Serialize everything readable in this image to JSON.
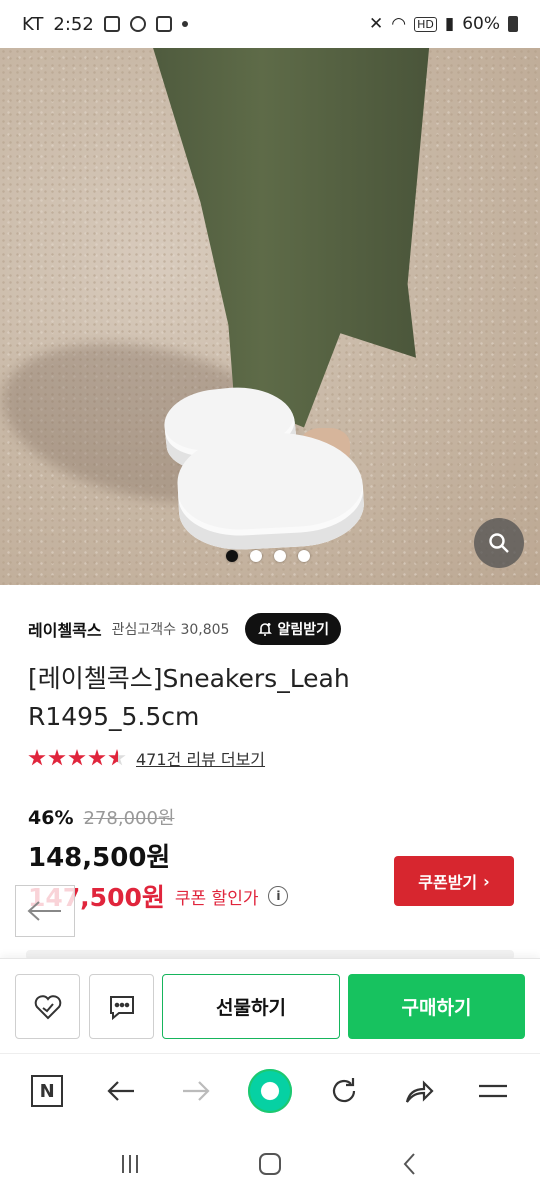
{
  "status_bar": {
    "carrier": "KT",
    "time": "2:52",
    "battery": "60%"
  },
  "hero": {
    "image_alt": "White platform sneakers on sandy ground",
    "carousel_pages": 4,
    "active_page": 1
  },
  "product": {
    "store_name": "레이첼콕스",
    "fans_label": "관심고객수 30,805",
    "alarm_label": "알림받기",
    "title": "[레이첼콕스]Sneakers_Leah R1495_5.5cm",
    "rating": 4.5,
    "review_link": "471건 리뷰 더보기",
    "discount_pct": "46%",
    "original_price": "278,000원",
    "sale_price": "148,500원",
    "coupon_price": "147,500원",
    "coupon_label": "쿠폰 할인가",
    "coupon_button": "쿠폰받기"
  },
  "buy_bar": {
    "gift_label": "선물하기",
    "purchase_label": "구매하기"
  },
  "icons": {
    "zoom": "search-icon",
    "alarm": "bell-plus-icon",
    "like": "heart-icon",
    "talk": "chat-icon",
    "browser_home": "naver-n-icon",
    "back": "arrow-left-icon",
    "forward": "arrow-right-icon",
    "green": "green-dot-icon",
    "reload": "reload-icon",
    "share": "share-icon",
    "menu": "hamburger-icon"
  },
  "colors": {
    "accent_red": "#e0253c",
    "buy_green": "#17c25f"
  }
}
